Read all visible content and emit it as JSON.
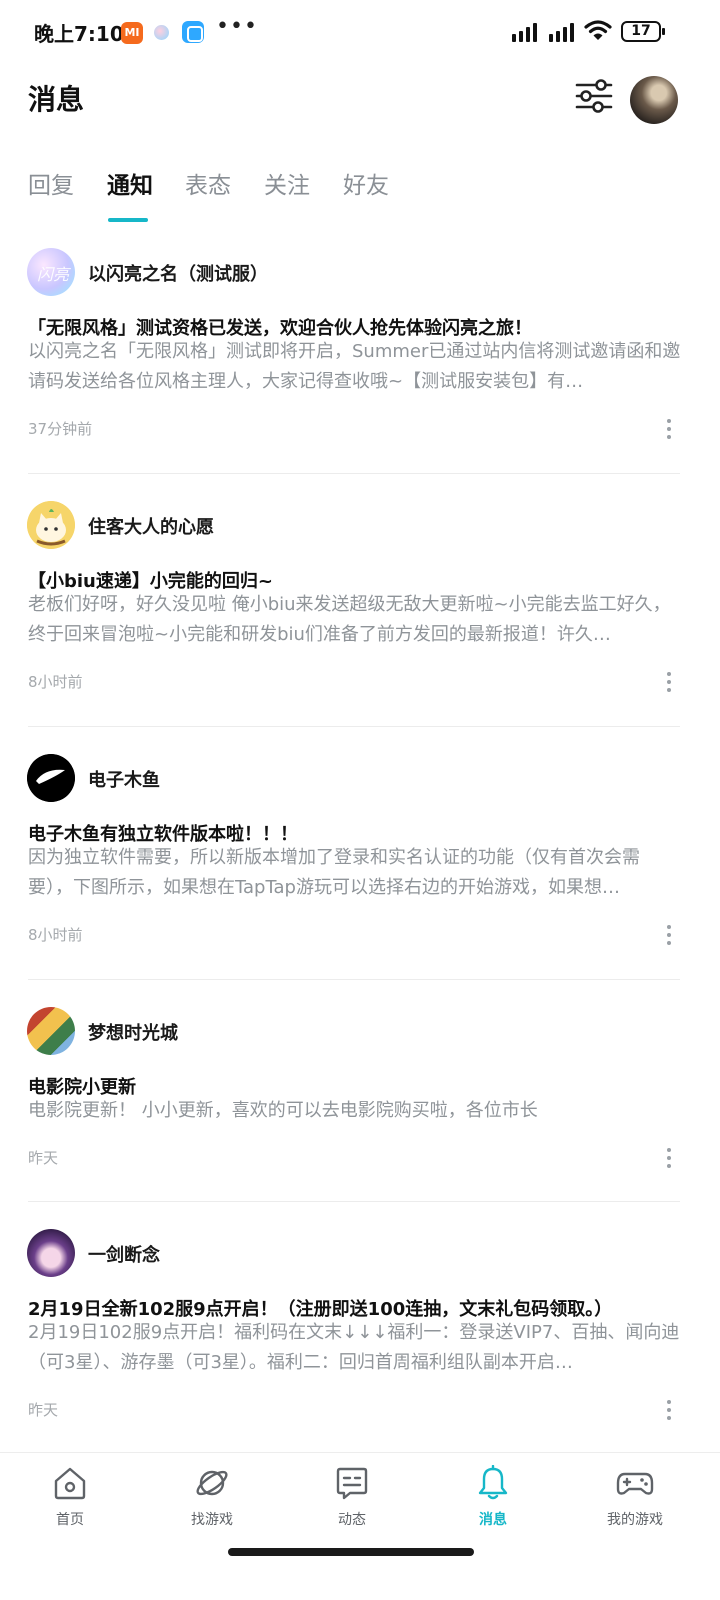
{
  "status_bar": {
    "time": "晚上7:10",
    "mi_badge": "MI",
    "battery": "17"
  },
  "header": {
    "title": "消息"
  },
  "tabs": [
    {
      "label": "回复",
      "active": false
    },
    {
      "label": "通知",
      "active": true
    },
    {
      "label": "表态",
      "active": false
    },
    {
      "label": "关注",
      "active": false
    },
    {
      "label": "好友",
      "active": false
    }
  ],
  "notifications": [
    {
      "source": "以闪亮之名（测试服）",
      "avatar_text": "闪亮",
      "title": "「无限风格」测试资格已发送，欢迎合伙人抢先体验闪亮之旅！",
      "body": "以闪亮之名「无限风格」测试即将开启，Summer已通过站内信将测试邀请函和邀请码发送给各位风格主理人，大家记得查收哦~【测试服安装包】有…",
      "time": "37分钟前"
    },
    {
      "source": "住客大人的心愿",
      "title": "【小biu速递】小完能的回归~",
      "body": "老板们好呀，好久没见啦 俺小biu来发送超级无敌大更新啦~小完能去监工好久，终于回来冒泡啦~小完能和研发biu们准备了前方发回的最新报道！许久…",
      "time": "8小时前"
    },
    {
      "source": "电子木鱼",
      "title": "电子木鱼有独立软件版本啦！！！",
      "body": "因为独立软件需要，所以新版本增加了登录和实名认证的功能（仅有首次会需要），下图所示，如果想在TapTap游玩可以选择右边的开始游戏，如果想…",
      "time": "8小时前"
    },
    {
      "source": "梦想时光城",
      "title": "电影院小更新",
      "body": "电影院更新！ 小小更新，喜欢的可以去电影院购买啦，各位市长",
      "time": "昨天"
    },
    {
      "source": "一剑断念",
      "title": "2月19日全新102服9点开启！（注册即送100连抽，文末礼包码领取。）",
      "body": "2月19日102服9点开启！福利码在文末↓↓↓福利一：登录送VIP7、百抽、闻向迪（可3星）、游存墨（可3星）。福利二：回归首周福利组队副本开启…",
      "time": "昨天"
    }
  ],
  "bottom_nav": [
    {
      "label": "首页",
      "icon": "home-icon",
      "active": false
    },
    {
      "label": "找游戏",
      "icon": "planet-icon",
      "active": false
    },
    {
      "label": "动态",
      "icon": "chat-card-icon",
      "active": false
    },
    {
      "label": "消息",
      "icon": "bell-icon",
      "active": true
    },
    {
      "label": "我的游戏",
      "icon": "gamepad-icon",
      "active": false
    }
  ],
  "colors": {
    "accent": "#16b7c8",
    "muted_text": "#8f9499"
  }
}
